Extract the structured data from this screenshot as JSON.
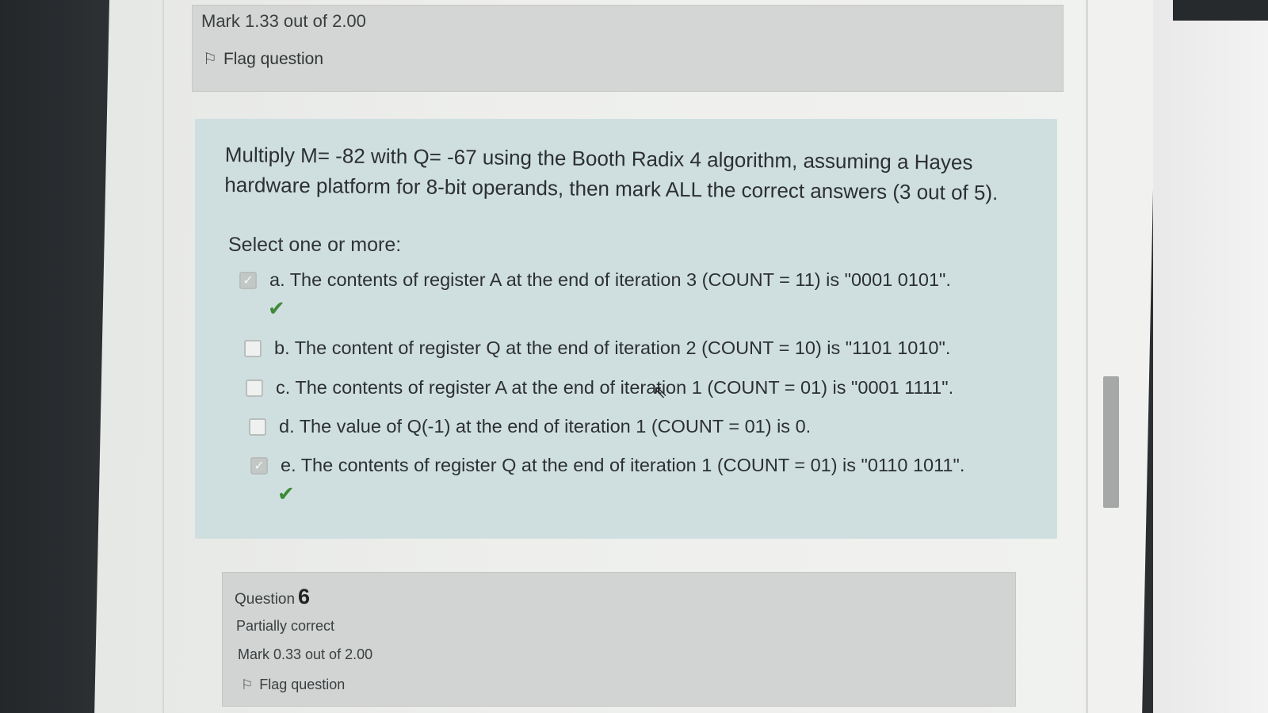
{
  "previous_question": {
    "mark": "Mark 1.33 out of 2.00",
    "flag_label": "Flag question",
    "flag_icon": "flag-icon"
  },
  "question": {
    "text_line1": "Multiply M= -82 with Q= -67 using the Booth Radix 4 algorithm, assuming a Hayes",
    "text_line2": "hardware platform for 8-bit operands, then mark ALL the correct answers (3 out of 5).",
    "select_label": "Select one or more:",
    "options": [
      {
        "label": "a. The contents of register A at the end of iteration 3 (COUNT  = 11) is \"0001 0101\".",
        "checked": true,
        "correct_mark": "✔"
      },
      {
        "label": "b. The content of register Q at the end of iteration 2 (COUNT = 10) is \"1101 1010\".",
        "checked": false,
        "correct_mark": ""
      },
      {
        "label": "c. The contents of register A at the end of iteration 1 (COUNT  = 01) is \"0001 1111\".",
        "checked": false,
        "correct_mark": ""
      },
      {
        "label": "d. The value of Q(-1) at the end of iteration 1 (COUNT = 01) is 0.",
        "checked": false,
        "correct_mark": ""
      },
      {
        "label": "e. The contents of register Q at the end of iteration 1 (COUNT  = 01) is \"0110 1011\".",
        "checked": true,
        "correct_mark": "✔"
      }
    ]
  },
  "next_question": {
    "title": "Question",
    "number": "6",
    "state": "Partially correct",
    "mark": "Mark 0.33 out of 2.00",
    "flag_label": "Flag question"
  },
  "colors": {
    "question_bg": "#cfdfe0",
    "info_bg": "#d3d6d4",
    "correct_tick": "#3f8a37"
  }
}
